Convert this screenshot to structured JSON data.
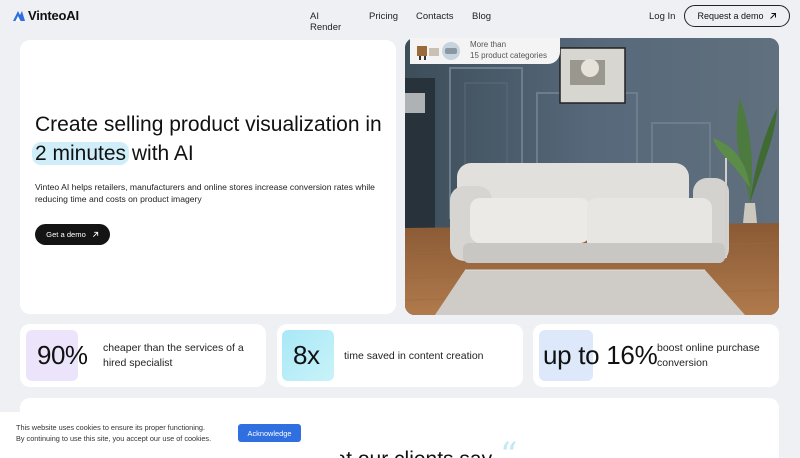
{
  "header": {
    "logo_text": "VinteoAI",
    "nav": [
      "AI Render",
      "Pricing",
      "Contacts",
      "Blog"
    ],
    "login": "Log In",
    "request_demo": "Request a demo",
    "arrow_icon": "arrow-up-right-icon"
  },
  "hero": {
    "title_before": "Create selling product visualization in ",
    "title_highlight": "2 minutes",
    "title_after": " with AI",
    "description": "Vinteo AI helps retailers, manufacturers and online stores increase conversion rates while reducing time and costs on product imagery",
    "cta": "Get a demo"
  },
  "badge": {
    "line1": "More than",
    "line2": "15 product categories"
  },
  "stats": [
    {
      "value": "90%",
      "label": "cheaper than the services of a hired specialist"
    },
    {
      "value": "8x",
      "label": "time saved in content creation"
    },
    {
      "value": "up to 16%",
      "label": "boost online purchase conversion"
    }
  ],
  "section": {
    "title": "What our clients say"
  },
  "cookie": {
    "line1": "This website uses cookies to ensure its proper functioning.",
    "line2": "By continuing to use this site, you accept our use of cookies.",
    "button": "Acknowledge"
  },
  "colors": {
    "accent": "#2f6fe0",
    "highlight": "#cfeef9",
    "background": "#eff0f3"
  }
}
